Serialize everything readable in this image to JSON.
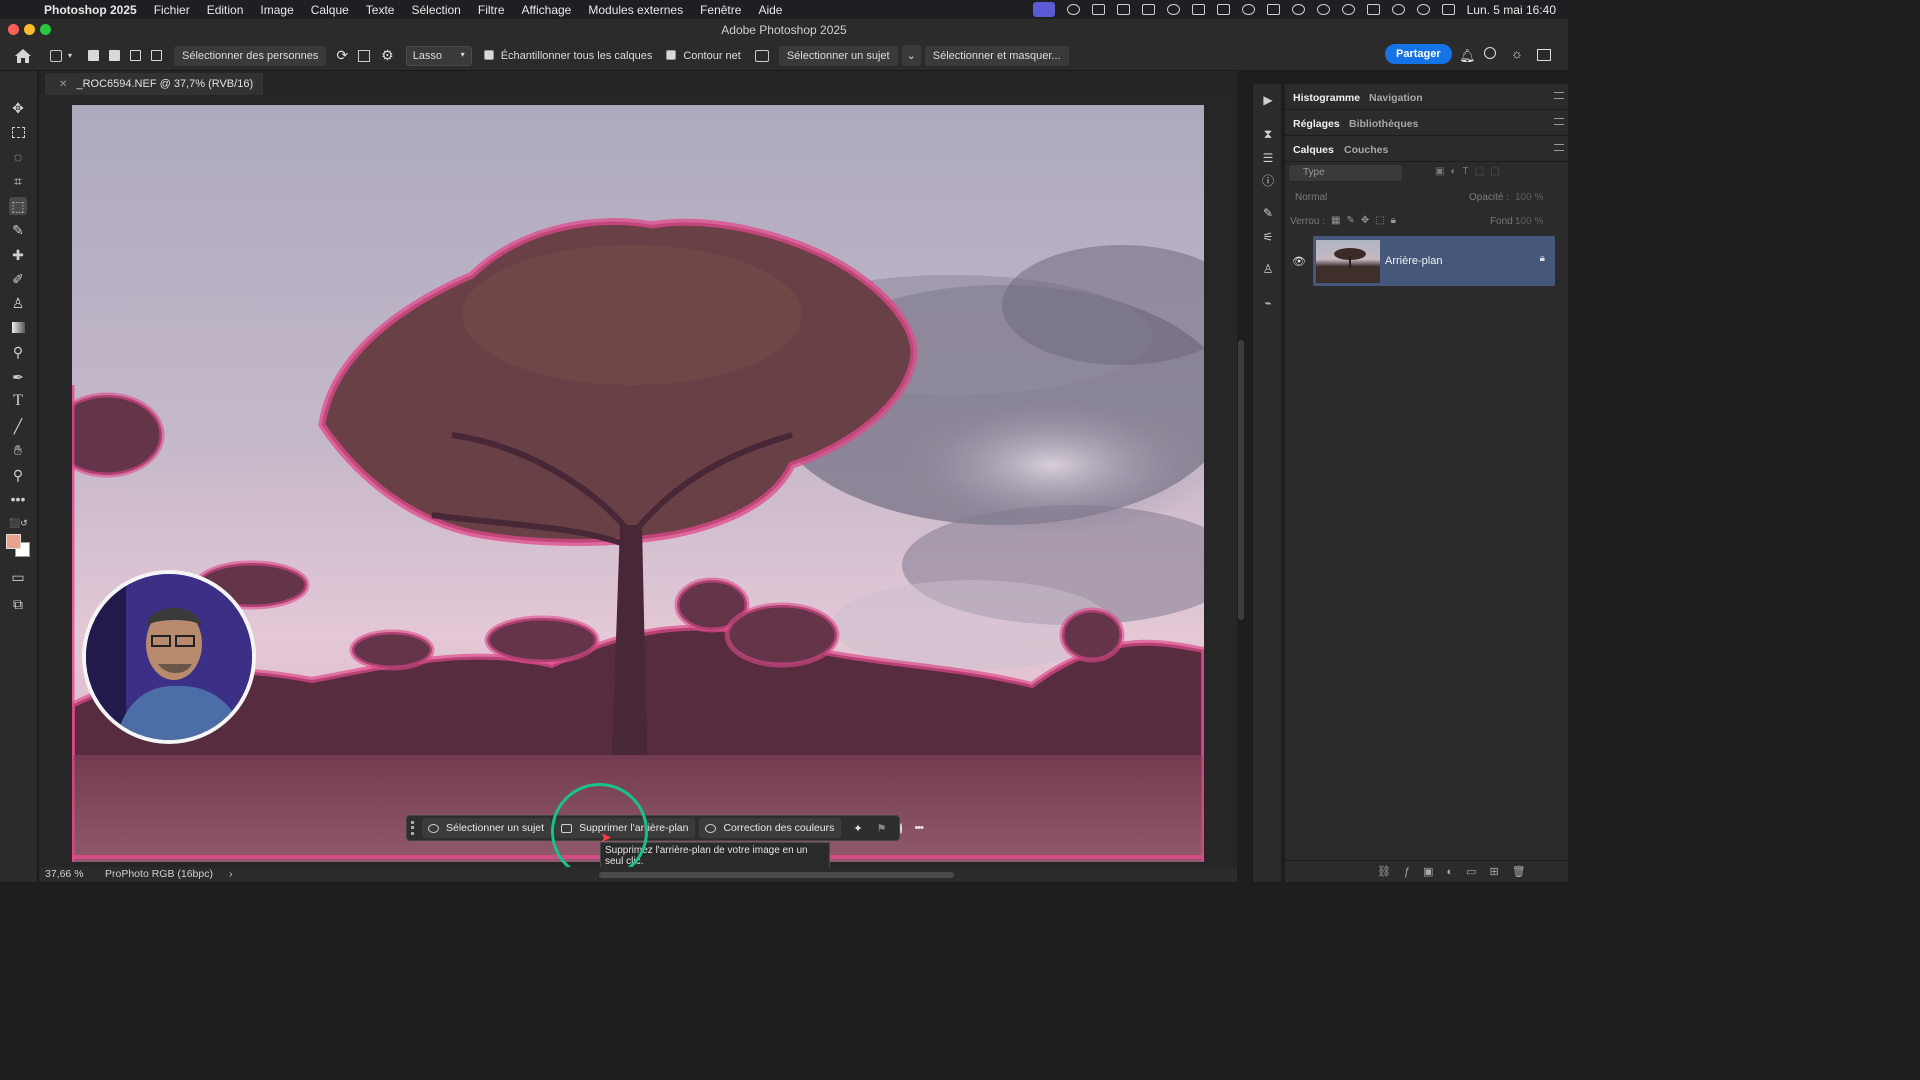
{
  "menubar": {
    "app": "Photoshop 2025",
    "items": [
      "Fichier",
      "Edition",
      "Image",
      "Calque",
      "Texte",
      "Sélection",
      "Filtre",
      "Affichage",
      "Modules externes",
      "Fenêtre",
      "Aide"
    ],
    "datetime": "Lun. 5 mai  16:40"
  },
  "window": {
    "title": "Adobe Photoshop 2025"
  },
  "options": {
    "select_people": "Sélectionner des personnes",
    "mode": "Lasso",
    "sample_all": "Échantillonner tous les calques",
    "sharp_edge": "Contour net",
    "select_subject": "Sélectionner un sujet",
    "select_mask": "Sélectionner et masquer...",
    "share": "Partager"
  },
  "document": {
    "tab_title": "_ROC6594.NEF @ 37,7% (RVB/16)",
    "zoom": "37,66 %",
    "profile": "ProPhoto RGB (16bpc)"
  },
  "contextual_bar": {
    "select_subject": "Sélectionner un sujet",
    "remove_bg": "Supprimer l'arrière-plan",
    "color_correction": "Correction des couleurs",
    "tooltip": "Supprimez l'arrière-plan de votre image en un seul clic."
  },
  "panels": {
    "histogram": "Histogramme",
    "navigation": "Navigation",
    "adjustments": "Réglages",
    "libraries": "Bibliothèques",
    "layers": "Calques",
    "channels": "Couches",
    "filter_placeholder": "Type",
    "blend_mode": "Normal",
    "opacity_label": "Opacité :",
    "opacity_value": "100 %",
    "lock_label": "Verrou :",
    "fill_label": "Fond :",
    "fill_value": "100 %",
    "layer_name": "Arrière-plan"
  },
  "colors": {
    "accent": "#1473e6",
    "selection_overlay": "#e04a8c",
    "highlight_ring": "#17c38a"
  }
}
